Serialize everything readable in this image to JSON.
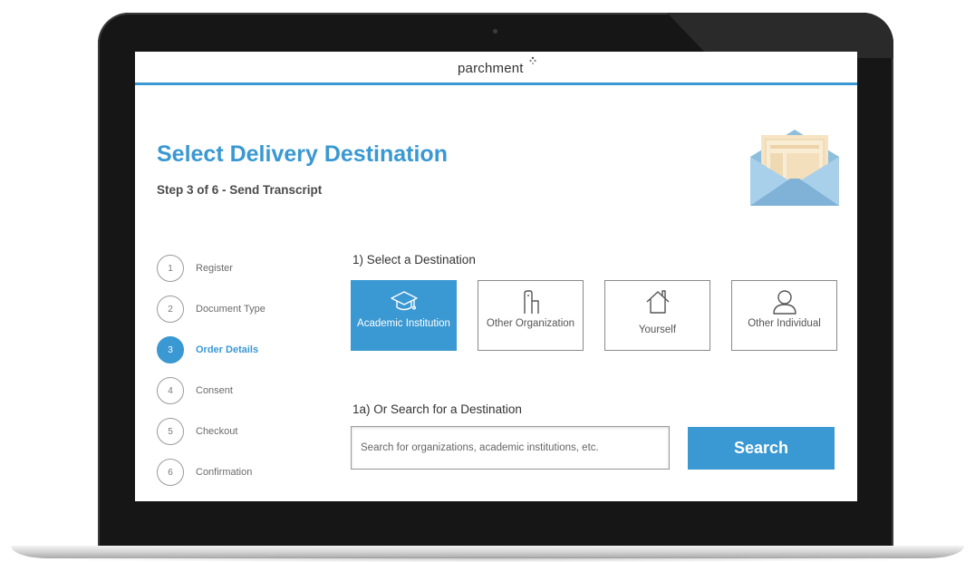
{
  "app": {
    "logo_text": "parchment"
  },
  "header": {
    "title": "Select Delivery Destination",
    "subtitle": "Step 3 of 6 - Send Transcript"
  },
  "steps": [
    {
      "number": "1",
      "label": "Register",
      "active": false
    },
    {
      "number": "2",
      "label": "Document Type",
      "active": false
    },
    {
      "number": "3",
      "label": "Order Details",
      "active": true
    },
    {
      "number": "4",
      "label": "Consent",
      "active": false
    },
    {
      "number": "5",
      "label": "Checkout",
      "active": false
    },
    {
      "number": "6",
      "label": "Confirmation",
      "active": false
    }
  ],
  "destination": {
    "heading": "1) Select a Destination",
    "options": [
      {
        "label": "Academic Institution",
        "icon": "graduation-cap-icon",
        "selected": true
      },
      {
        "label": "Other Organization",
        "icon": "building-icon",
        "selected": false
      },
      {
        "label": "Yourself",
        "icon": "house-icon",
        "selected": false
      },
      {
        "label": "Other Individual",
        "icon": "person-icon",
        "selected": false
      }
    ]
  },
  "search": {
    "heading": "1a) Or Search for a Destination",
    "placeholder": "Search for organizations, academic institutions, etc.",
    "value": "",
    "button_label": "Search"
  },
  "colors": {
    "accent": "#3a98d2",
    "bezel": "#161616",
    "text_dark": "#333333"
  }
}
